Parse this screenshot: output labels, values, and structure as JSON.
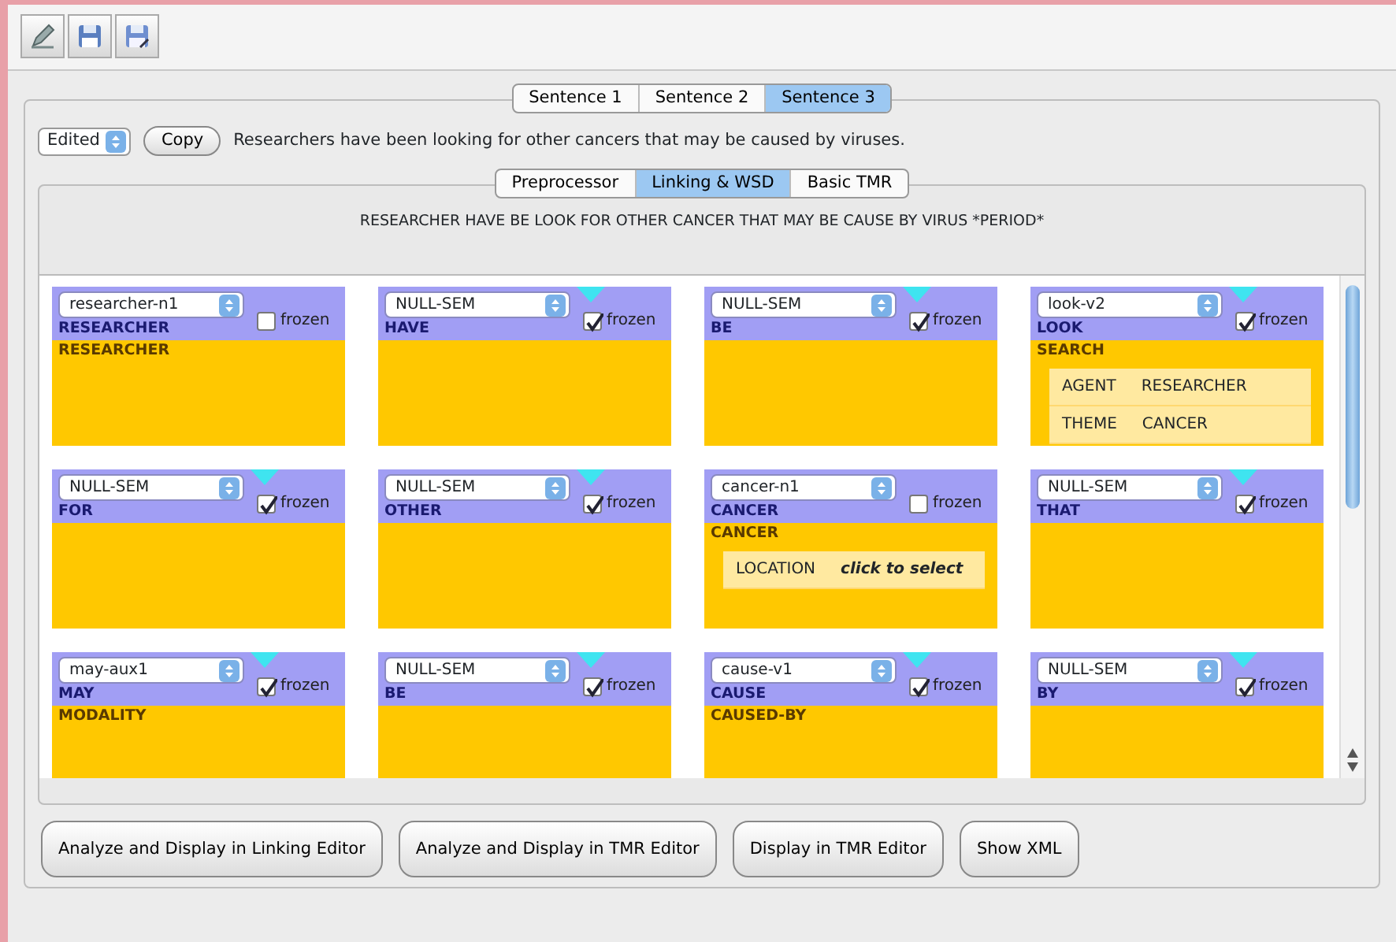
{
  "toolbar": {
    "buttons": [
      {
        "kind": "edit"
      },
      {
        "kind": "save"
      },
      {
        "kind": "save-as"
      }
    ]
  },
  "sentence_tabs": [
    {
      "label": "Sentence 1",
      "selected": false
    },
    {
      "label": "Sentence 2",
      "selected": false
    },
    {
      "label": "Sentence 3",
      "selected": true
    }
  ],
  "sentence_bar": {
    "mode": "Edited",
    "copy_button": "Copy",
    "sentence": "Researchers have been looking for other cancers that may be caused by viruses."
  },
  "stage_tabs": [
    {
      "label": "Preprocessor",
      "selected": false
    },
    {
      "label": "Linking & WSD",
      "selected": true
    },
    {
      "label": "Basic TMR",
      "selected": false
    }
  ],
  "lemmas": "RESEARCHER HAVE BE LOOK FOR OTHER CANCER THAT MAY BE CAUSE BY VIRUS *PERIOD*",
  "word_cards": [
    {
      "sense": "researcher-n1",
      "frozen": false,
      "frozen_label": "frozen",
      "word": "RESEARCHER",
      "concept": "RESEARCHER"
    },
    {
      "sense": "NULL-SEM",
      "frozen": true,
      "frozen_label": "frozen",
      "word": "HAVE"
    },
    {
      "sense": "NULL-SEM",
      "frozen": true,
      "frozen_label": "frozen",
      "word": "BE"
    },
    {
      "sense": "look-v2",
      "frozen": true,
      "frozen_label": "frozen",
      "word": "LOOK",
      "concept": "SEARCH",
      "properties": [
        {
          "name": "AGENT",
          "value": "RESEARCHER",
          "kind": "filled"
        },
        {
          "name": "THEME",
          "value": "CANCER",
          "kind": "filled"
        }
      ]
    },
    {
      "sense": "NULL-SEM",
      "frozen": true,
      "frozen_label": "frozen",
      "word": "FOR"
    },
    {
      "sense": "NULL-SEM",
      "frozen": true,
      "frozen_label": "frozen",
      "word": "OTHER"
    },
    {
      "sense": "cancer-n1",
      "frozen": false,
      "frozen_label": "frozen",
      "word": "CANCER",
      "concept": "CANCER",
      "properties": [
        {
          "name": "LOCATION",
          "value": "click to select",
          "kind": "unset"
        }
      ]
    },
    {
      "sense": "NULL-SEM",
      "frozen": true,
      "frozen_label": "frozen",
      "word": "THAT"
    },
    {
      "sense": "may-aux1",
      "frozen": true,
      "frozen_label": "frozen",
      "word": "MAY",
      "concept": "MODALITY"
    },
    {
      "sense": "NULL-SEM",
      "frozen": true,
      "frozen_label": "frozen",
      "word": "BE"
    },
    {
      "sense": "cause-v1",
      "frozen": true,
      "frozen_label": "frozen",
      "word": "CAUSE",
      "concept": "CAUSED-BY"
    },
    {
      "sense": "NULL-SEM",
      "frozen": true,
      "frozen_label": "frozen",
      "word": "BY"
    }
  ],
  "action_buttons": [
    "Analyze and Display in Linking Editor",
    "Analyze and Display in TMR Editor",
    "Display in TMR Editor",
    "Show XML"
  ]
}
